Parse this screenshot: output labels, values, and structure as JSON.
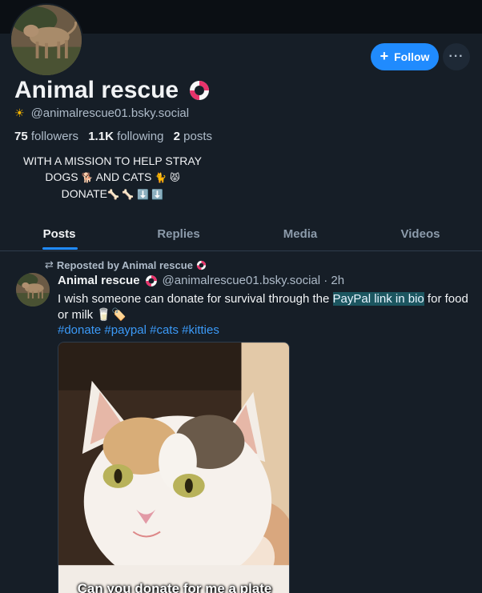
{
  "profile": {
    "display_name": "Animal rescue",
    "handle": "@animalrescue01.bsky.social",
    "followers_count": "75",
    "followers_label": "followers",
    "following_count": "1.1K",
    "following_label": "following",
    "posts_count": "2",
    "posts_label": "posts",
    "bio_lines": [
      "WITH A MISSION TO HELP STRAY",
      "DOGS",
      "AND CATS",
      "DONATE"
    ]
  },
  "actions": {
    "follow_label": "Follow",
    "more_label": "···"
  },
  "tabs": [
    {
      "label": "Posts",
      "active": true
    },
    {
      "label": "Replies",
      "active": false
    },
    {
      "label": "Media",
      "active": false
    },
    {
      "label": "Videos",
      "active": false
    }
  ],
  "post": {
    "repost_label": "Reposted by Animal rescue",
    "author": "Animal rescue",
    "handle_time": "@animalrescue01.bsky.social · 2h",
    "text_before": "I wish someone can donate for survival through the ",
    "text_link": "PayPal link in bio",
    "text_after": " for food or milk",
    "hashtags": [
      "#donate",
      "#paypal",
      "#cats",
      "#kitties"
    ],
    "media_caption": "Can you donate for me a plate"
  },
  "colors": {
    "background": "#161e27",
    "accent": "#208bfe",
    "hashtag": "#3b9af8",
    "muted_text": "#aebbc9"
  },
  "icons": [
    "plus-icon",
    "ellipsis-icon",
    "lifebuoy-icon",
    "sun-icon",
    "repost-icon",
    "dog-icon",
    "cat-icon",
    "bone-icon",
    "down-arrow-icon",
    "milk-icon",
    "tag-icon"
  ]
}
